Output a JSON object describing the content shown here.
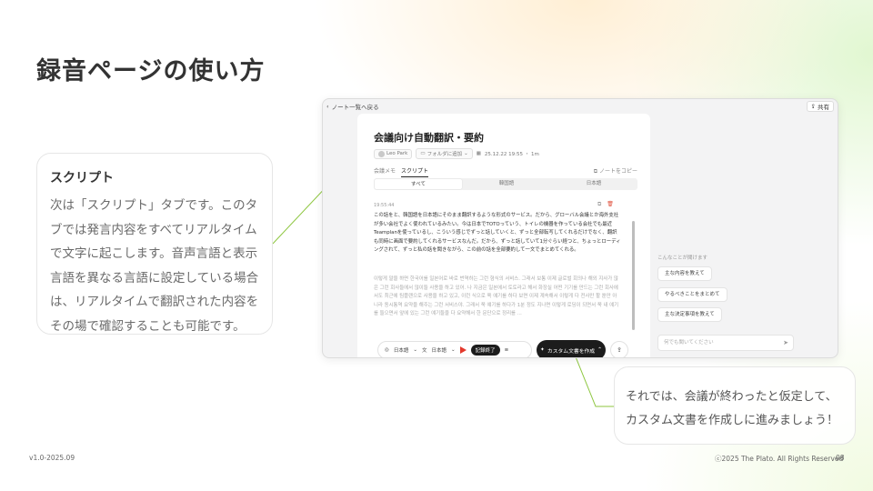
{
  "page": {
    "title": "録音ページの使い方"
  },
  "left_card": {
    "title": "スクリプト",
    "body": "次は「スクリプト」タブです。このタブでは発言内容をすべてリアルタイムで文字に起こします。音声言語と表示言語を異なる言語に設定している場合は、リアルタイムで翻訳された内容をその場で確認することも可能です。"
  },
  "right_card": {
    "body": "それでは、会議が終わったと仮定して、カスタム文書を作成しに進みましょう！"
  },
  "app": {
    "back_link": "ノート一覧へ戻る",
    "share_label": "共有",
    "doc_title": "会議向け自動翻訳・要約",
    "meta": {
      "user": "Leo Park",
      "folder": "フォルダに追加",
      "date": "25.12.22 19:55 ・ 1m"
    },
    "tabs": {
      "tab_a": "会議メモ",
      "tab_b": "スクリプト",
      "copy_note": "ノートをコピー"
    },
    "segments": [
      "すべて",
      "韓国語",
      "日本語"
    ],
    "timestamp": "19:55:44",
    "paragraph_ja": "この話をと、韓国語を日本語にそのまま翻訳するような形式のサービス。だから、グローバル会議とか海外支社が多い会社でよく使われているみたい。今は日本でTOTOっていう、トイレの機器を作っている会社でも最近Teamplanを使っているし、こういう感じでずっと話していくと、ずっと全部転写してくれるだけでなく、翻訳も同時に画面で要約してくれるサービスなんだ。だから、ずっと話していて1分ぐらい経つと、ちょっとローディングされて、ずっと私の話を聞きながら、この前の話を全部要約して一文でまとめてくれる。",
    "paragraph_ko": "이렇게 말을 하면 한국어를 일본어로 바로 번역하는 그런 형식의 서비스. 그래서 보통 이제 글로벌 회의나 해외 지사가 많은 그런 회사들에서 많이들 사용을 하고 있어. 나 지금은 일본에서 토토라고 해서 화장실 어떤 기기를 만드는 그런 회사에서도 최근에 팀플랜으로 사용을 하고 있고, 이런 식으로 쭉 얘기를 하다 보면 이제 계속해서 이렇게 다 전사만 할 뿐만 아니라 동시통역 요약을 해주는 그런 서비스야. 그래서 쭉 얘기를 하다가 1분 정도 지나면 이렇게 로딩이 되면서 쭉 내 얘기를 들으면서 앞에 있는 그런 얘기들을 다 요약해서 한 문단으로 정리를 ...",
    "controls": {
      "speech_lang": "日本語",
      "display_lang": "日本語",
      "end_label": "記録終了",
      "custom_doc": "カスタム文書を作成"
    },
    "side": {
      "label": "こんなことが聞けます",
      "suggestions": [
        "主な内容を教えて",
        "やるべきことをまとめて",
        "主な決定事項を教えて"
      ],
      "ask_placeholder": "何でも聞いてください"
    }
  },
  "footer": {
    "version": "v1.0-2025.09",
    "copyright": "ⓒ2025 The Plato. All Rights Reserved",
    "page_number": "08"
  },
  "colors": {
    "accent_green": "#8dc63f",
    "record_red": "#e3392c",
    "dark_button": "#1c1c1c"
  }
}
